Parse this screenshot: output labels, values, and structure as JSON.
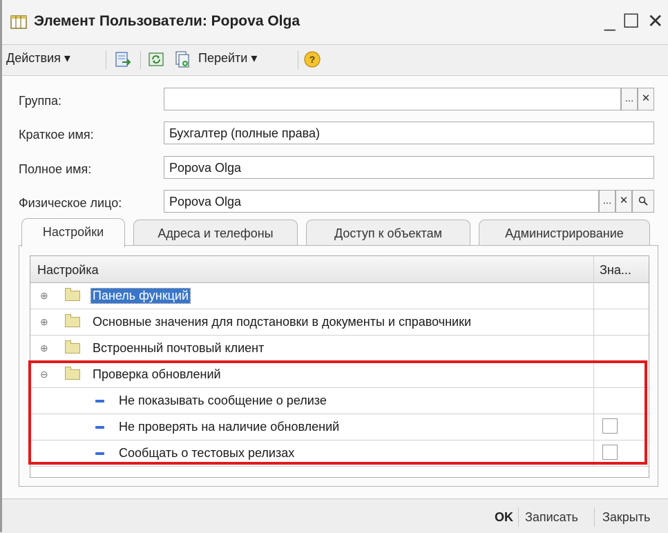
{
  "window": {
    "title": "Элемент Пользователи: Popova Olga",
    "minimize": "_",
    "maximize": "☐",
    "close": "✕"
  },
  "toolbar": {
    "actions_label": "Действия ▾",
    "goto_label": "Перейти ▾"
  },
  "form": {
    "group": {
      "label": "Группа:",
      "value": ""
    },
    "short_name": {
      "label": "Краткое имя:",
      "value": "Бухгалтер (полные права)"
    },
    "full_name": {
      "label": "Полное имя:",
      "value": "Popova Olga"
    },
    "person": {
      "label": "Физическое лицо:",
      "value": "Popova Olga"
    },
    "select_glyph": "...",
    "clear_glyph": "✕"
  },
  "tabs": [
    {
      "label": "Настройки"
    },
    {
      "label": "Адреса и телефоны"
    },
    {
      "label": "Доступ к объектам"
    },
    {
      "label": "Администрирование"
    }
  ],
  "grid": {
    "col_setting": "Настройка",
    "col_value": "Зна...",
    "rows": [
      {
        "label": "Панель функций",
        "expander": "⊕"
      },
      {
        "label": "Основные значения для подстановки в документы и справочники",
        "expander": "⊕"
      },
      {
        "label": "Встроенный почтовый клиент",
        "expander": "⊕"
      },
      {
        "label": "Проверка обновлений",
        "expander": "⊖"
      },
      {
        "label": "Не показывать сообщение о релизе"
      },
      {
        "label": "Не проверять на наличие обновлений"
      },
      {
        "label": "Сообщать о тестовых релизах"
      }
    ]
  },
  "footer": {
    "ok": "OK",
    "save": "Записать",
    "close": "Закрыть"
  }
}
